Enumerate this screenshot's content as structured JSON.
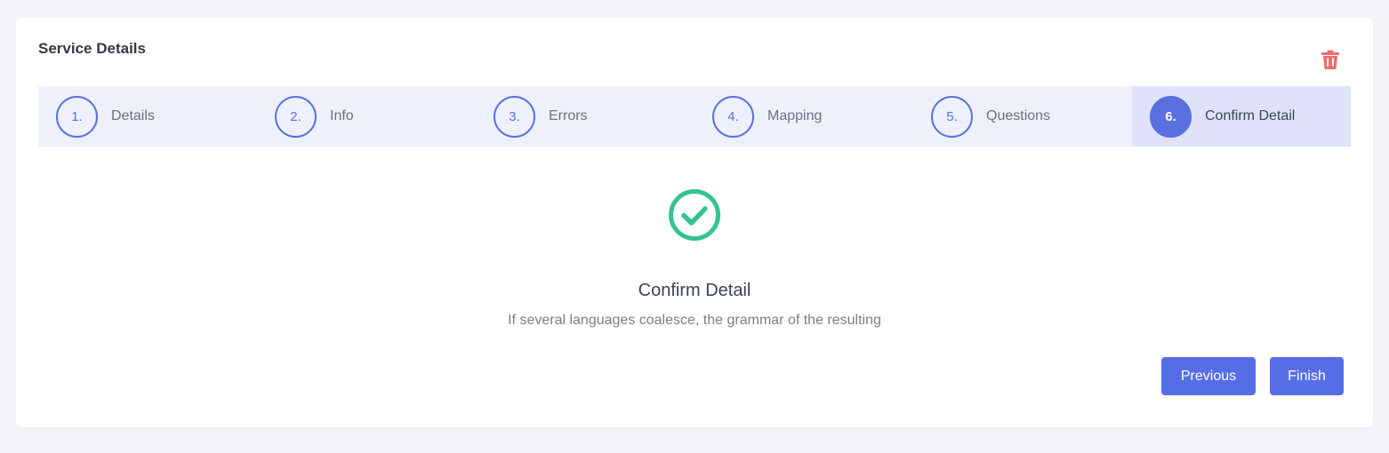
{
  "card": {
    "title": "Service Details"
  },
  "icons": {
    "delete": "trash-icon",
    "success": "check-circle-icon"
  },
  "colors": {
    "accent": "#556ee6",
    "success": "#34c38f",
    "danger": "#f46a6a",
    "step_bg": "#eef0fb",
    "step_active_bg": "#dfe2fa"
  },
  "steps": [
    {
      "num": "1.",
      "label": "Details"
    },
    {
      "num": "2.",
      "label": "Info"
    },
    {
      "num": "3.",
      "label": "Errors"
    },
    {
      "num": "4.",
      "label": "Mapping"
    },
    {
      "num": "5.",
      "label": "Questions"
    },
    {
      "num": "6.",
      "label": "Confirm Detail",
      "active": true
    }
  ],
  "confirm": {
    "title": "Confirm Detail",
    "text": "If several languages coalesce, the grammar of the resulting"
  },
  "buttons": {
    "previous": "Previous",
    "finish": "Finish"
  }
}
